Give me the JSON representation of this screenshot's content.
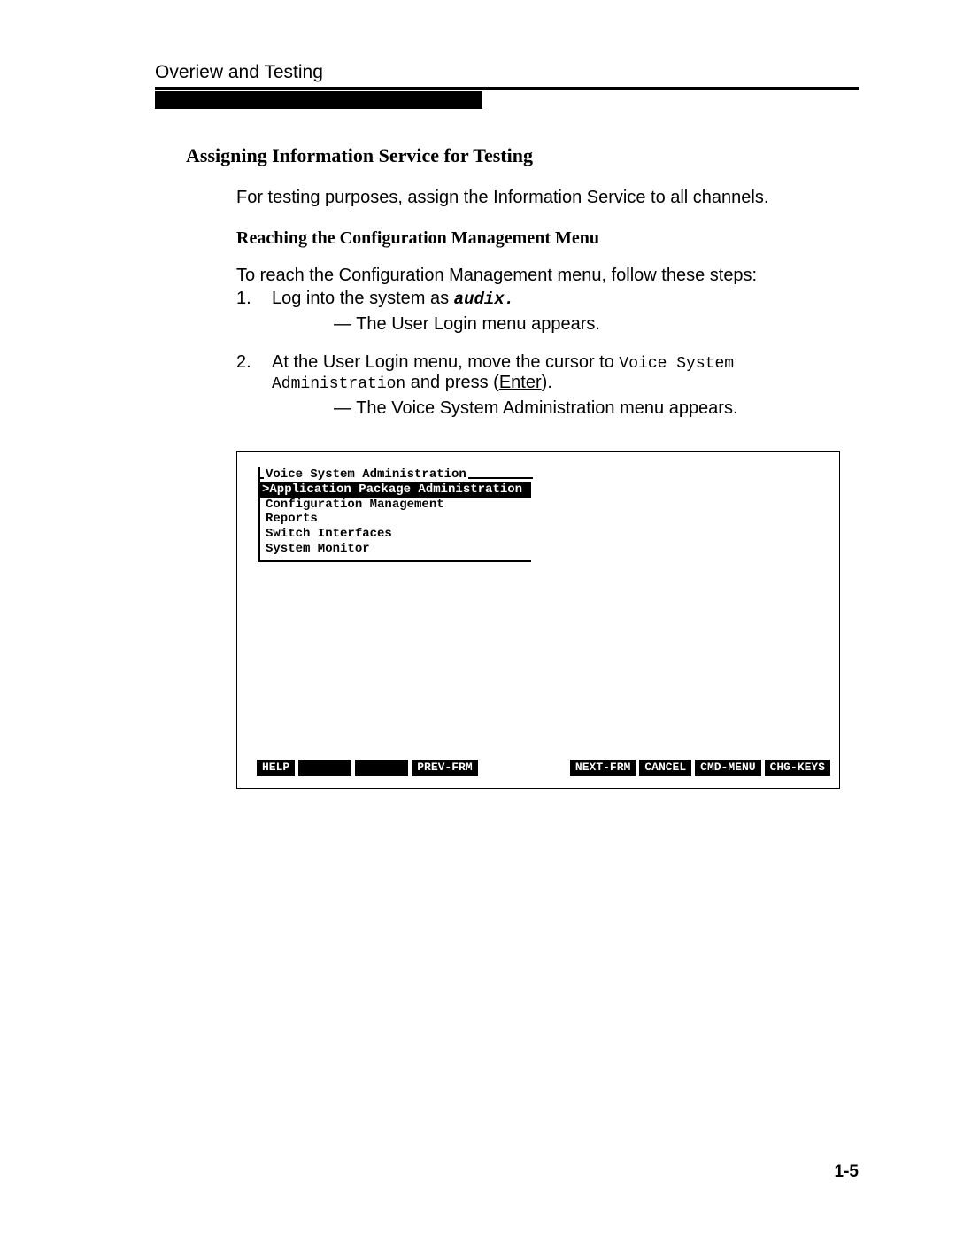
{
  "header": {
    "title": "Overiew and Testing"
  },
  "section": {
    "title": "Assigning Information Service for Testing",
    "intro": "For testing purposes, assign the Information Service to all channels.",
    "subTitle": "Reaching the Configuration Management Menu",
    "stepsIntro": "To reach the Configuration Management menu, follow these steps:",
    "steps": [
      {
        "num": "1.",
        "pre": "Log into the system as ",
        "code": "audix.",
        "note": "— The User Login menu appears."
      },
      {
        "num": "2.",
        "pre": "At the User Login menu, move the cursor to ",
        "mono": "Voice System Administration",
        "mid": " and press (",
        "key": "Enter",
        "post": ").",
        "note": "— The Voice System Administration menu appears."
      }
    ]
  },
  "terminal": {
    "menuTitle": "Voice System Administration",
    "selected": ">Application Package Administration",
    "items": [
      "Configuration Management",
      "Reports",
      "Switch Interfaces",
      "System Monitor"
    ],
    "fnKeys": {
      "left": [
        "HELP"
      ],
      "leftExtra": "PREV-FRM",
      "right": [
        "NEXT-FRM",
        "CANCEL",
        "CMD-MENU",
        "CHG-KEYS"
      ]
    }
  },
  "pageNum": "1-5"
}
